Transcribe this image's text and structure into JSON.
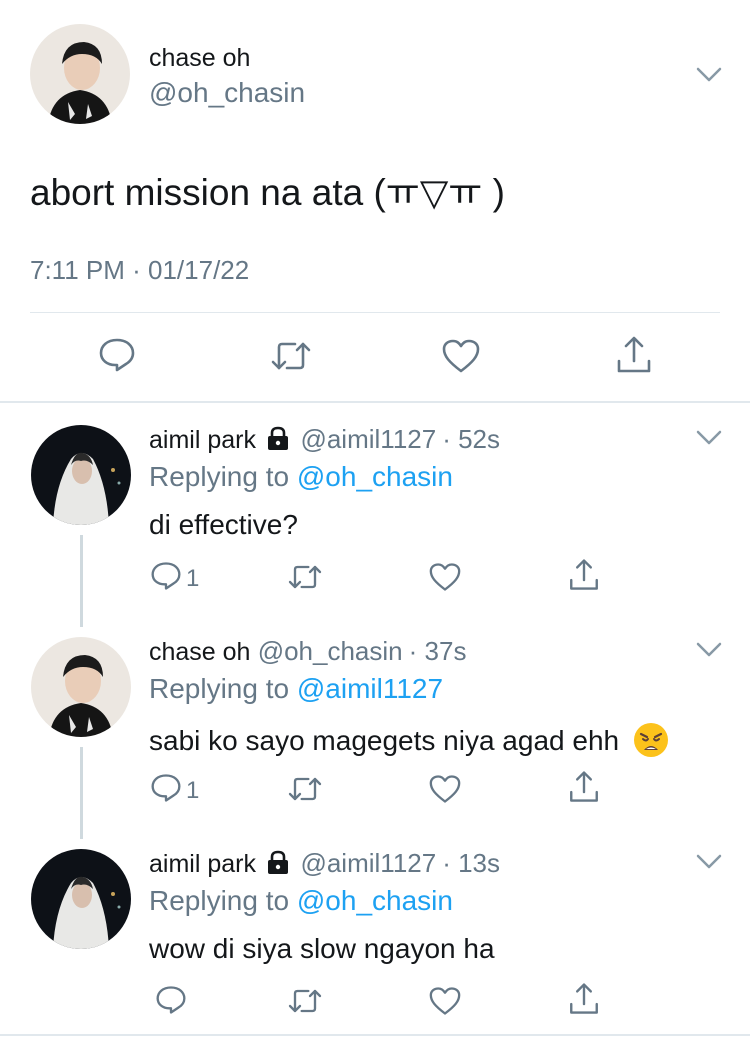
{
  "main_tweet": {
    "display_name": "chase oh",
    "handle": "@oh_chasin",
    "text": "abort mission na ata (ㅠ▽ㅠ )",
    "timestamp": "7:11 PM · 01/17/22"
  },
  "replies": [
    {
      "display_name": "aimil park",
      "handle": "@aimil1127",
      "time": "· 52s",
      "replying_prefix": "Replying to",
      "replying_to": "@oh_chasin",
      "text": "di effective?",
      "reply_count": "1",
      "protected": true
    },
    {
      "display_name": "chase oh",
      "handle": "@oh_chasin",
      "time": "· 37s",
      "replying_prefix": "Replying to",
      "replying_to": "@aimil1127",
      "text": "sabi ko sayo magegets niya agad ehh",
      "reply_count": "1",
      "protected": false
    },
    {
      "display_name": "aimil park",
      "handle": "@aimil1127",
      "time": "· 13s",
      "replying_prefix": "Replying to",
      "replying_to": "@oh_chasin",
      "text": "wow di siya slow ngayon ha",
      "reply_count": "",
      "protected": true
    }
  ],
  "colors": {
    "link": "#1da1f2",
    "muted": "#657786",
    "divider": "#e1e8ed",
    "thread_line": "#cfd9de"
  },
  "icons": [
    "reply-icon",
    "retweet-icon",
    "like-icon",
    "share-icon",
    "chevron-down-icon",
    "lock-icon",
    "weary-face-emoji"
  ]
}
